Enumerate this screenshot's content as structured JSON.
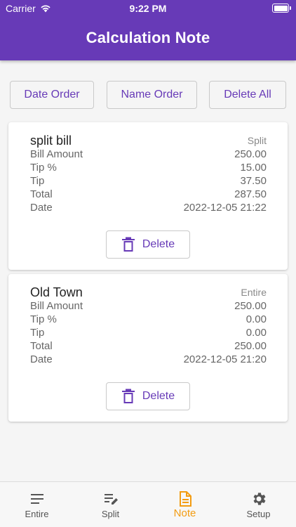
{
  "status_bar": {
    "carrier": "Carrier",
    "time": "9:22 PM"
  },
  "app_bar": {
    "title": "Calculation Note"
  },
  "toolbar": {
    "date_order": "Date Order",
    "name_order": "Name Order",
    "delete_all": "Delete All"
  },
  "notes": [
    {
      "name": "split bill",
      "type": "Split",
      "rows": [
        {
          "label": "Bill Amount",
          "value": "250.00"
        },
        {
          "label": "Tip %",
          "value": "15.00"
        },
        {
          "label": "Tip",
          "value": "37.50"
        },
        {
          "label": "Total",
          "value": "287.50"
        },
        {
          "label": "Date",
          "value": "2022-12-05 21:22"
        }
      ],
      "delete_label": "Delete"
    },
    {
      "name": "Old Town",
      "type": "Entire",
      "rows": [
        {
          "label": "Bill Amount",
          "value": "250.00"
        },
        {
          "label": "Tip %",
          "value": "0.00"
        },
        {
          "label": "Tip",
          "value": "0.00"
        },
        {
          "label": "Total",
          "value": "250.00"
        },
        {
          "label": "Date",
          "value": "2022-12-05 21:20"
        }
      ],
      "delete_label": "Delete"
    }
  ],
  "bottom_nav": [
    {
      "label": "Entire",
      "icon": "lines-icon",
      "active": false
    },
    {
      "label": "Split",
      "icon": "edit-list-icon",
      "active": false
    },
    {
      "label": "Note",
      "icon": "note-icon",
      "active": true
    },
    {
      "label": "Setup",
      "icon": "gear-icon",
      "active": false
    }
  ],
  "colors": {
    "primary": "#673ab7",
    "accent": "#f39c12",
    "background": "#f5f5f5"
  }
}
